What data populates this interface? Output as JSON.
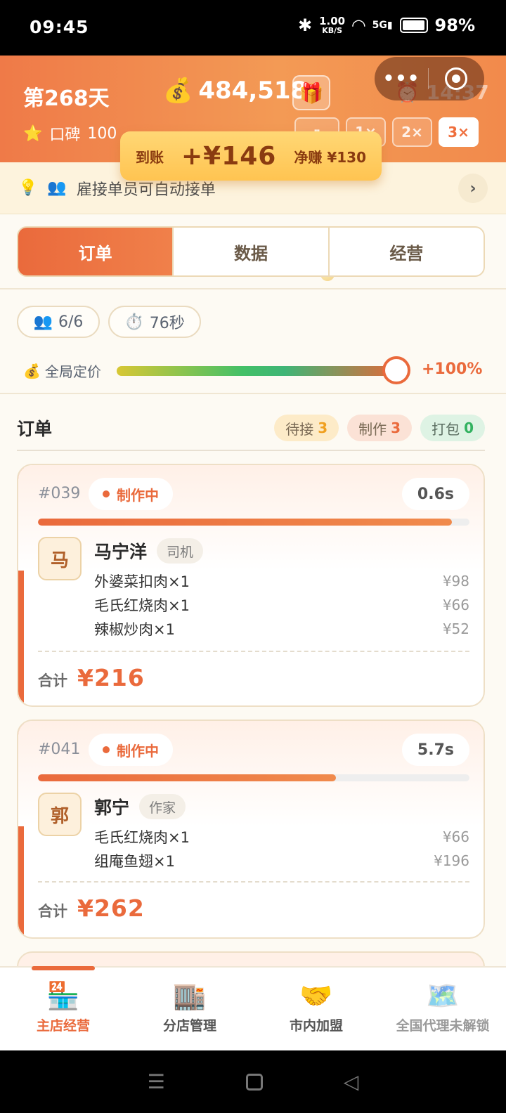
{
  "status_bar": {
    "time": "09:45",
    "net_speed_value": "1.00",
    "net_speed_unit": "KB/S",
    "signal": "5G",
    "battery": "98%"
  },
  "header": {
    "day": "第268天",
    "money": "484,518",
    "game_time": "14:37",
    "reputation_label": "口碑",
    "reputation_value": "100",
    "speeds": [
      "1×",
      "2×",
      "3×"
    ],
    "active_speed": "3×"
  },
  "toast": {
    "label": "到账",
    "amount": "+¥146",
    "net": "净赚 ¥130"
  },
  "tip": {
    "text": "雇接单员可自动接单"
  },
  "tabs": [
    "订单",
    "数据",
    "经营"
  ],
  "stats": {
    "staff": "6/6",
    "timer": "76秒"
  },
  "pricing": {
    "label": "全局定价",
    "value": "+100%",
    "level_percent": 100
  },
  "orders": {
    "title": "订单",
    "badges": [
      {
        "label": "待接",
        "count": "3"
      },
      {
        "label": "制作",
        "count": "3"
      },
      {
        "label": "打包",
        "count": "0"
      }
    ],
    "total_label": "合计",
    "list": [
      {
        "id": "#039",
        "status": "制作中",
        "time_left": "0.6s",
        "progress": 0.96,
        "avatar": "马",
        "customer": "马宁洋",
        "role": "司机",
        "items": [
          {
            "name": "外婆菜扣肉×1",
            "price": "¥98"
          },
          {
            "name": "毛氏红烧肉×1",
            "price": "¥66"
          },
          {
            "name": "辣椒炒肉×1",
            "price": "¥52"
          }
        ],
        "total": "¥216"
      },
      {
        "id": "#041",
        "status": "制作中",
        "time_left": "5.7s",
        "progress": 0.69,
        "avatar": "郭",
        "customer": "郭宁",
        "role": "作家",
        "items": [
          {
            "name": "毛氏红烧肉×1",
            "price": "¥66"
          },
          {
            "name": "组庵鱼翅×1",
            "price": "¥196"
          }
        ],
        "total": "¥262"
      }
    ]
  },
  "bottom_nav": [
    {
      "label": "主店经营",
      "icon": "store-24h-icon"
    },
    {
      "label": "分店管理",
      "icon": "building-icon"
    },
    {
      "label": "市内加盟",
      "icon": "handshake-icon"
    },
    {
      "label": "全国代理未解锁",
      "icon": "map-icon"
    }
  ],
  "colors": {
    "accent": "#ea6a3c",
    "header": "#f39a55",
    "background": "#fdfaf3"
  }
}
